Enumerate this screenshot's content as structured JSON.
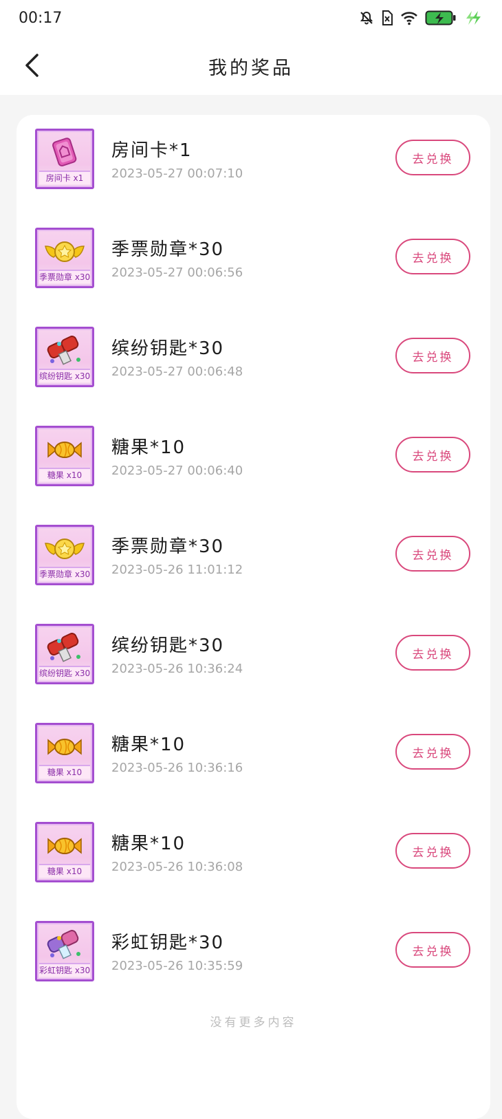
{
  "status": {
    "time": "00:17",
    "icons": [
      "bell-off-icon",
      "sim-off-icon",
      "wifi-icon",
      "battery-charging-icon",
      "fast-charge-icon"
    ],
    "battery_color": "#3dbb4f"
  },
  "header": {
    "title": "我的奖品",
    "back_icon": "chevron-left-icon"
  },
  "prizes": [
    {
      "name": "房间卡*1",
      "date": "2023-05-27 00:07:10",
      "thumb_label": "房间卡 x1",
      "icon": "room-card-icon",
      "button": "去兑换"
    },
    {
      "name": "季票勋章*30",
      "date": "2023-05-27 00:06:56",
      "thumb_label": "季票勋章 x30",
      "icon": "badge-icon",
      "button": "去兑换"
    },
    {
      "name": "缤纷钥匙*30",
      "date": "2023-05-27 00:06:48",
      "thumb_label": "缤纷钥匙 x30",
      "icon": "key-icon",
      "button": "去兑换"
    },
    {
      "name": "糖果*10",
      "date": "2023-05-27 00:06:40",
      "thumb_label": "糖果 x10",
      "icon": "candy-icon",
      "button": "去兑换"
    },
    {
      "name": "季票勋章*30",
      "date": "2023-05-26 11:01:12",
      "thumb_label": "季票勋章 x30",
      "icon": "badge-icon",
      "button": "去兑换"
    },
    {
      "name": "缤纷钥匙*30",
      "date": "2023-05-26 10:36:24",
      "thumb_label": "缤纷钥匙 x30",
      "icon": "key-icon",
      "button": "去兑换"
    },
    {
      "name": "糖果*10",
      "date": "2023-05-26 10:36:16",
      "thumb_label": "糖果 x10",
      "icon": "candy-icon",
      "button": "去兑换"
    },
    {
      "name": "糖果*10",
      "date": "2023-05-26 10:36:08",
      "thumb_label": "糖果 x10",
      "icon": "candy-icon",
      "button": "去兑换"
    },
    {
      "name": "彩虹钥匙*30",
      "date": "2023-05-26 10:35:59",
      "thumb_label": "彩虹钥匙 x30",
      "icon": "rainbow-key-icon",
      "button": "去兑换"
    }
  ],
  "footer": {
    "no_more": "没有更多内容"
  },
  "colors": {
    "accent": "#d9487c",
    "thumb_border": "#a44ed0",
    "date_text": "#a6a6a6"
  }
}
